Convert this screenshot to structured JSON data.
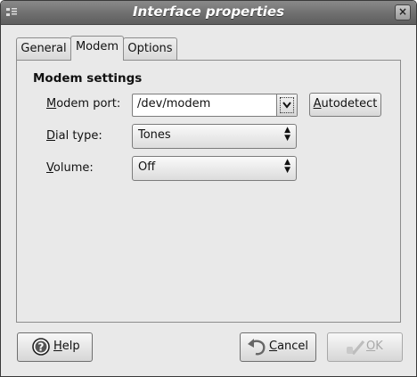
{
  "window": {
    "title": "Interface properties",
    "close_glyph": "×"
  },
  "tabs": [
    {
      "label": "General",
      "active": false
    },
    {
      "label": "Modem",
      "active": true
    },
    {
      "label": "Options",
      "active": false
    }
  ],
  "modem_settings": {
    "section_title": "Modem settings",
    "modem_port": {
      "label_mnemonic": "M",
      "label_rest": "odem port:",
      "value": "/dev/modem"
    },
    "autodetect": {
      "mnemonic": "A",
      "rest": "utodetect"
    },
    "dial_type": {
      "label_mnemonic": "D",
      "label_rest": "ial type:",
      "value": "Tones"
    },
    "volume": {
      "label_mnemonic": "V",
      "label_rest": "olume:",
      "value": "Off"
    }
  },
  "buttons": {
    "help": {
      "mnemonic": "H",
      "rest": "elp",
      "icon": "help-icon"
    },
    "cancel": {
      "mnemonic": "C",
      "rest": "ancel",
      "icon": "undo-icon"
    },
    "ok": {
      "mnemonic": "O",
      "rest": "K",
      "icon": "ok-icon",
      "disabled": true
    }
  }
}
